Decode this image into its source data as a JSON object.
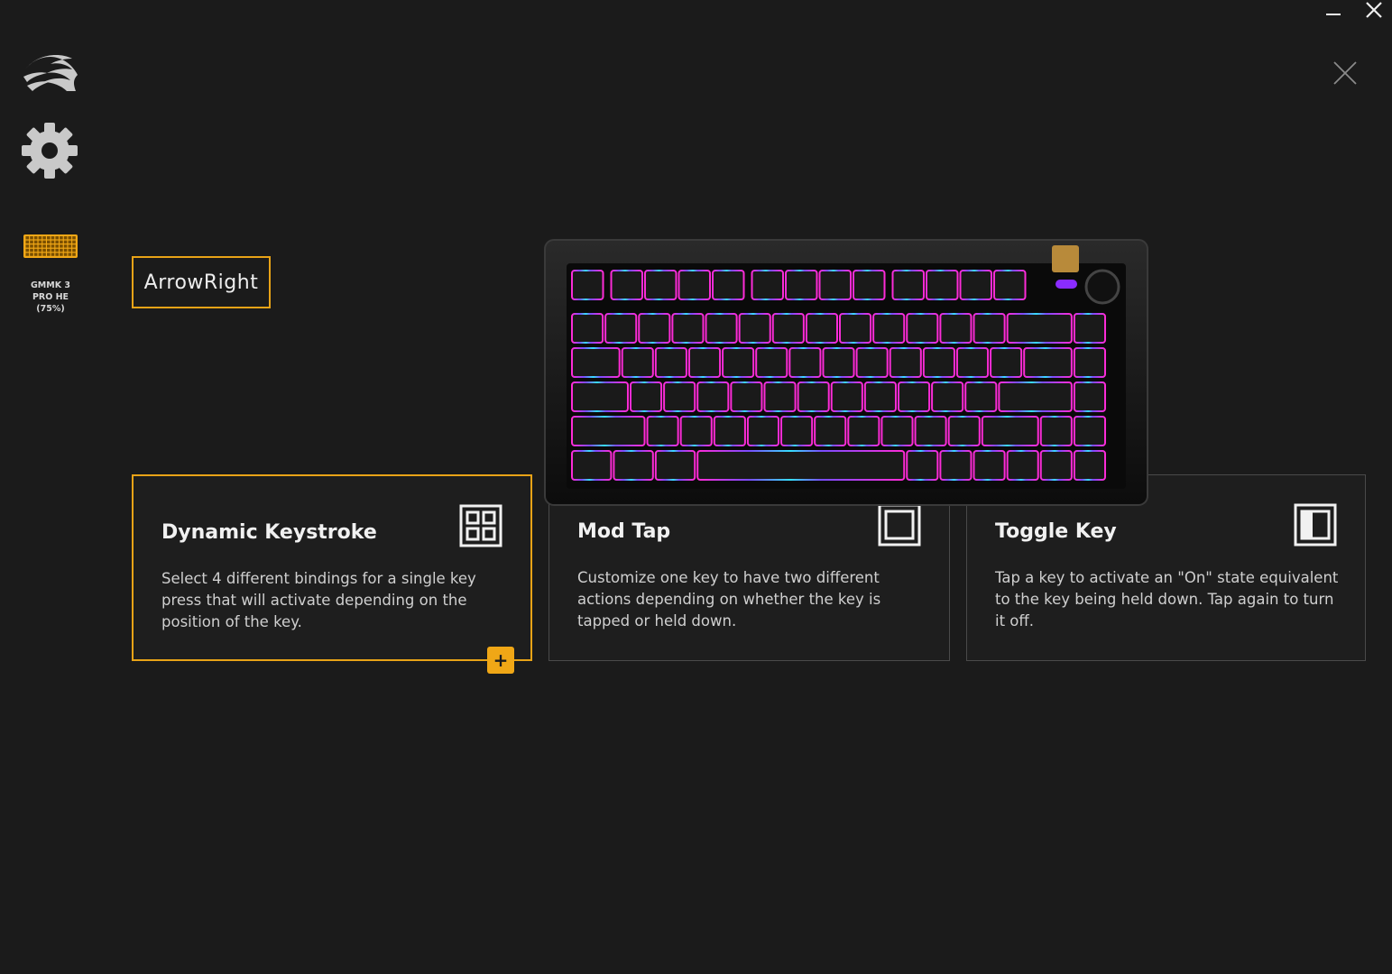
{
  "window": {
    "minimize_icon": "minimize-icon",
    "close_icon": "close-icon"
  },
  "sidebar": {
    "logo_icon": "brand-logo-icon",
    "settings_icon": "gear-icon",
    "device": {
      "icon": "keyboard-icon",
      "label": "GMMK 3\nPRO HE\n(75%)"
    }
  },
  "editor": {
    "selected_key": "ArrowRight",
    "close_icon": "close-icon"
  },
  "cards": [
    {
      "title": "Dynamic Keystroke",
      "description": "Select 4 different bindings for a single key press that will activate depending on the position of the key.",
      "icon": "quad-grid-icon",
      "add_label": "+"
    },
    {
      "title": "Mod Tap",
      "description": "Customize one key to have two different actions depending on whether the key is tapped or held down.",
      "icon": "square-icon"
    },
    {
      "title": "Toggle Key",
      "description": "Tap a key to activate an \"On\" state equivalent to the key being held down. Tap again to turn it off.",
      "icon": "toggle-square-icon"
    }
  ],
  "keyboard_image": "gmmk-keyboard-rgb-image",
  "colors": {
    "background": "#1b1b1b",
    "accent": "#f0a716",
    "card_border": "#4a4a4a"
  }
}
